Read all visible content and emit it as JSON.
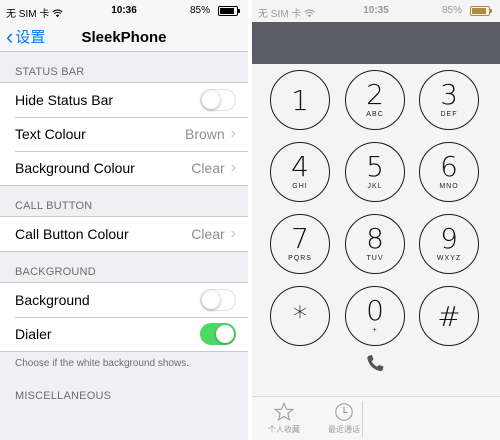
{
  "left": {
    "status_bar": {
      "carrier": "无 SIM 卡 ",
      "time": "10:36",
      "battery": "85%",
      "battery_level": 0.85
    },
    "nav": {
      "back_label": "设置",
      "title": "SleekPhone"
    },
    "sections": {
      "status_bar": {
        "header": "STATUS BAR",
        "hide_status_bar": {
          "label": "Hide Status Bar",
          "on": false
        },
        "text_colour": {
          "label": "Text Colour",
          "value": "Brown"
        },
        "background_colour": {
          "label": "Background Colour",
          "value": "Clear"
        }
      },
      "call_button": {
        "header": "CALL BUTTON",
        "call_button_colour": {
          "label": "Call Button Colour",
          "value": "Clear"
        }
      },
      "background": {
        "header": "BACKGROUND",
        "background": {
          "label": "Background",
          "on": false
        },
        "dialer": {
          "label": "Dialer",
          "on": true
        },
        "footer": "Choose if the white background shows."
      },
      "miscellaneous": {
        "header": "MISCELLANEOUS"
      }
    },
    "colors": {
      "accent": "#007aff",
      "toggle_on": "#4cd964"
    }
  },
  "right": {
    "status_bar": {
      "carrier": "无 SIM 卡 ",
      "time": "10:35",
      "battery": "85%",
      "battery_level": 0.85
    },
    "keys": [
      {
        "digit": "1",
        "letters": ""
      },
      {
        "digit": "2",
        "letters": "ABC"
      },
      {
        "digit": "3",
        "letters": "DEF"
      },
      {
        "digit": "4",
        "letters": "GHI"
      },
      {
        "digit": "5",
        "letters": "JKL"
      },
      {
        "digit": "6",
        "letters": "MNO"
      },
      {
        "digit": "7",
        "letters": "PQRS"
      },
      {
        "digit": "8",
        "letters": "TUV"
      },
      {
        "digit": "9",
        "letters": "WXYZ"
      },
      {
        "digit": "*",
        "letters": ""
      },
      {
        "digit": "0",
        "letters": "+"
      },
      {
        "digit": "#",
        "letters": ""
      }
    ],
    "tabs": [
      {
        "label": "个人收藏",
        "icon": "star-icon"
      },
      {
        "label": "最近通话",
        "icon": "clock-icon"
      }
    ],
    "call_icon": "phone-icon"
  }
}
